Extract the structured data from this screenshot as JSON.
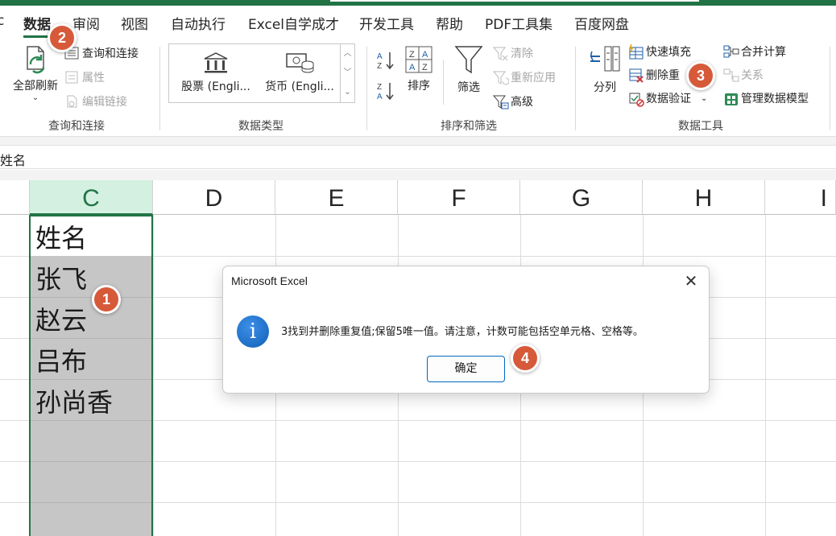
{
  "tabs": {
    "partial_left": "c",
    "data": "数据",
    "review": "审阅",
    "view": "视图",
    "automate": "自动执行",
    "excel_self": "Excel自学成才",
    "developer": "开发工具",
    "help": "帮助",
    "pdf": "PDF工具集",
    "baidu": "百度网盘"
  },
  "ribbon": {
    "queries": {
      "refresh_all": "全部刷新",
      "queries_connections": "查询和连接",
      "properties": "属性",
      "edit_links": "编辑链接",
      "group_label": "查询和连接"
    },
    "data_types": {
      "stocks": "股票 (Engli...",
      "currencies": "货币 (Engli...",
      "group_label": "数据类型"
    },
    "sort_filter": {
      "sort": "排序",
      "filter": "筛选",
      "clear": "清除",
      "reapply": "重新应用",
      "advanced": "高级",
      "group_label": "排序和筛选"
    },
    "data_tools": {
      "text_to_columns": "分列",
      "flash_fill": "快速填充",
      "remove_duplicates": "删除重",
      "data_validation": "数据验证",
      "consolidate": "合并计算",
      "relationships": "关系",
      "manage_model": "管理数据模型",
      "group_label": "数据工具"
    }
  },
  "formula_bar": {
    "content": "姓名"
  },
  "columns": [
    "C",
    "D",
    "E",
    "F",
    "G",
    "H",
    "I"
  ],
  "cells": {
    "c1": "姓名",
    "c2": "张飞",
    "c3": "赵云",
    "c4": "吕布",
    "c5": "孙尚香"
  },
  "badges": {
    "b1": "1",
    "b2": "2",
    "b3": "3",
    "b4": "4"
  },
  "dialog": {
    "title": "Microsoft Excel",
    "close": "✕",
    "info": "i",
    "message": "3找到并删除重复值;保留5唯一值。请注意，计数可能包括空单元格、空格等。",
    "ok": "确定"
  },
  "colors": {
    "excel_green": "#217346",
    "badge": "#d65a3a",
    "info_blue": "#1a73d0",
    "selection_fill": "#c6c6c6"
  }
}
